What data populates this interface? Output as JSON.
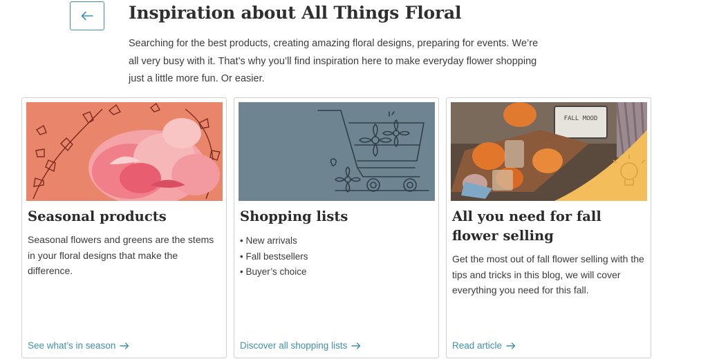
{
  "header": {
    "title": "Inspiration about All Things Floral",
    "intro": "Searching for the best products, creating amazing floral designs, preparing for events. We’re all very busy with it. That’s why you’ll find inspiration here to make everyday flower shopping just a little more fun. Or easier."
  },
  "colors": {
    "accent": "#3f8fb0",
    "card_border": "#cfcfcf",
    "seasonal_bg": "#e9856a",
    "shopping_bg": "#6f8491",
    "fall_bg": "#f2bd5a"
  },
  "cards": [
    {
      "title": "Seasonal products",
      "description": "Seasonal flowers and greens are the stems in your floral designs that make the difference.",
      "link": "See what’s in season",
      "image_icon": "peony-illustration"
    },
    {
      "title": "Shopping lists",
      "items": [
        "New arrivals",
        "Fall bestsellers",
        "Buyer’s choice"
      ],
      "link": "Discover all shopping lists",
      "image_icon": "shopping-cart-illustration"
    },
    {
      "title": "All you need for fall flower selling",
      "description": "Get the most out of fall flower selling with the tips and tricks in this blog, we will cover everything you need for this fall.",
      "link": "Read article",
      "image_icon": "fall-decor-photo",
      "image_sign": "FALL MOOD"
    }
  ]
}
